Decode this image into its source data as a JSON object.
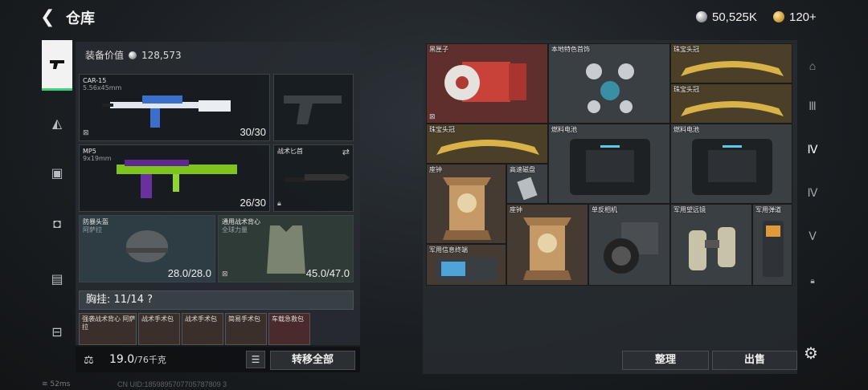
{
  "header": {
    "title": "仓库",
    "silver_amount": "50,525K",
    "gold_amount": "120+"
  },
  "left": {
    "equip_value_label": "装备价值",
    "equip_value": "128,573",
    "slots": {
      "primary1": {
        "name": "CAR-15",
        "caliber": "5.56x45mm",
        "count": "30/30"
      },
      "primary2": {
        "name": "MP5",
        "caliber": "9x19mm",
        "count": "26/30"
      },
      "melee": {
        "name": "战术匕首"
      },
      "helmet": {
        "name": "防暴头盔",
        "sub": "阿萨拉",
        "count": "28.0/28.0"
      },
      "armor": {
        "name": "通用战术背心",
        "sub": "全球力量",
        "count": "45.0/47.0"
      }
    },
    "chest_rig": "胸挂: 11/14 ?",
    "mini_slots": [
      "强袭战术背心 阿萨拉",
      "战术手术包",
      "战术手术包",
      "简易手术包",
      "车载急救包"
    ],
    "weight": "19.0",
    "weight_max": "/76千克",
    "transfer_all": "转移全部"
  },
  "right": {
    "items": [
      "黑匣子",
      "本地特色首饰",
      "珠宝头冠",
      "珠宝头冠",
      "珠宝头冠",
      "燃料电池",
      "燃料电池",
      "座钟",
      "高速磁盘",
      "座钟",
      "单反相机",
      "军用望远镜",
      "军用弹道",
      "军用信息终端"
    ],
    "tidy": "整理",
    "sell": "出售"
  },
  "status": {
    "ping": "52ms",
    "uid": "CN UID:1859895707705787809 3"
  },
  "colors": {
    "accent_green": "#3fd17a",
    "panel": "#282d32"
  }
}
